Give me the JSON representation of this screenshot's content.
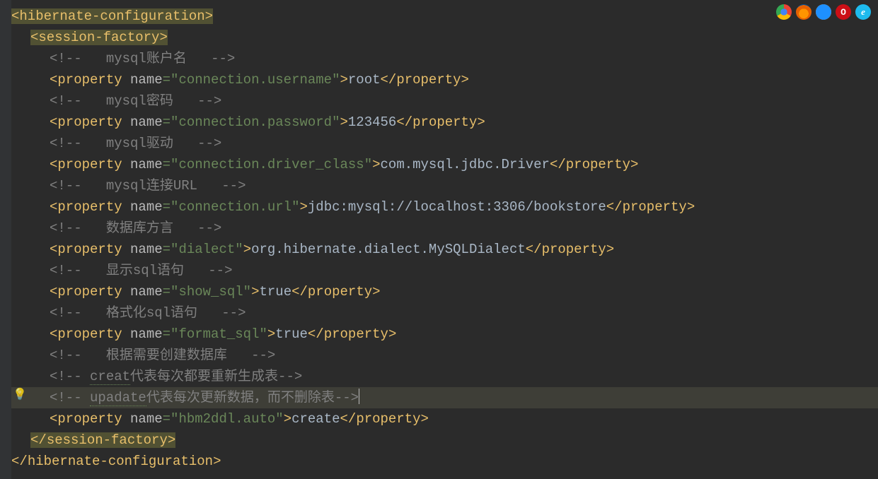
{
  "code": {
    "root_open": "hibernate-configuration",
    "root_close": "hibernate-configuration",
    "session_open": "session-factory",
    "session_close": "session-factory",
    "comment_open": "<!--",
    "comment_close": "-->",
    "c1": "mysql账户名",
    "c2": "mysql密码",
    "c3": "mysql驱动",
    "c4": "mysql连接URL",
    "c5": "数据库方言",
    "c6": "显示sql语句",
    "c7": "格式化sql语句",
    "c8": "根据需要创建数据库",
    "c9a": "creat",
    "c9b": "代表每次都要重新生成表",
    "c10a": "upadate",
    "c10b": "代表每次更新数据，而不删除表",
    "prop_tag": "property",
    "name_attr": "name",
    "eq": "=",
    "q": "\"",
    "p1_name": "connection.username",
    "p1_val": "root",
    "p2_name": "connection.password",
    "p2_val": "123456",
    "p3_name": "connection.driver_class",
    "p3_val": "com.mysql.jdbc.Driver",
    "p4_name": "connection.url",
    "p4_val": "jdbc:mysql://localhost:3306/bookstore",
    "p5_name": "dialect",
    "p5_val": "org.hibernate.dialect.MySQLDialect",
    "p6_name": "show_sql",
    "p6_val": "true",
    "p7_name": "format_sql",
    "p7_val": "true",
    "p8_name": "hbm2ddl.auto",
    "p8_val": "create"
  },
  "icons": {
    "bulb": "💡",
    "opera": "O",
    "ie": "e"
  }
}
